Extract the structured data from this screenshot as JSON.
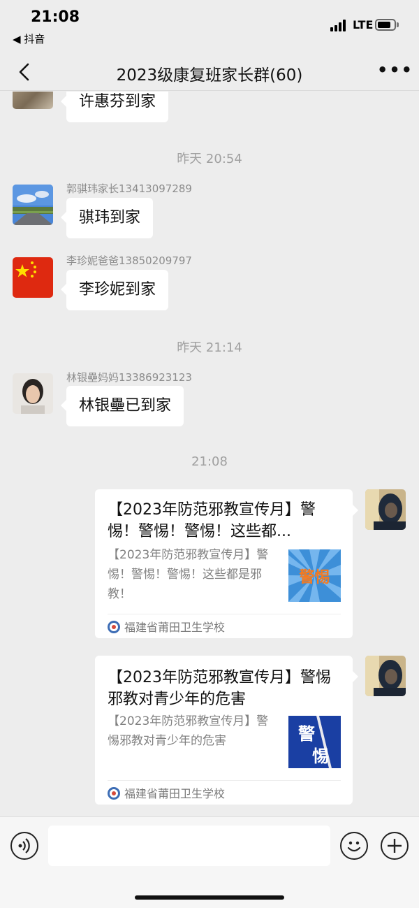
{
  "status_bar": {
    "time": "21:08",
    "back_app": "◀ 抖音",
    "network": "LTE"
  },
  "nav": {
    "title": "2023级康复班家长群(60)",
    "more": "•••"
  },
  "messages": [
    {
      "text": "许惠芬到家"
    },
    {
      "timestamp": "昨天 20:54"
    },
    {
      "sender": "郭骐玮家长13413097289",
      "text": "骐玮到家"
    },
    {
      "sender": "李珍妮爸爸13850209797",
      "text": "李珍妮到家"
    },
    {
      "timestamp": "昨天 21:14"
    },
    {
      "sender": "林银壘妈妈13386923123",
      "text": "林银壘已到家"
    },
    {
      "timestamp": "21:08"
    }
  ],
  "cards": [
    {
      "title": "【2023年防范邪教宣传月】警惕！警惕！警惕！这些都...",
      "desc": "【2023年防范邪教宣传月】警惕！警惕！警惕！这些都是邪教！",
      "thumb_text": "警惕",
      "source": "福建省莆田卫生学校"
    },
    {
      "title": "【2023年防范邪教宣传月】警惕邪教对青少年的危害",
      "desc": "【2023年防范邪教宣传月】警惕邪教对青少年的危害",
      "thumb_text": "警惕",
      "source": "福建省莆田卫生学校"
    }
  ],
  "input": {
    "placeholder": ""
  },
  "colors": {
    "background": "#ededed",
    "bubble": "#ffffff",
    "timestamp": "#a0a0a0"
  }
}
